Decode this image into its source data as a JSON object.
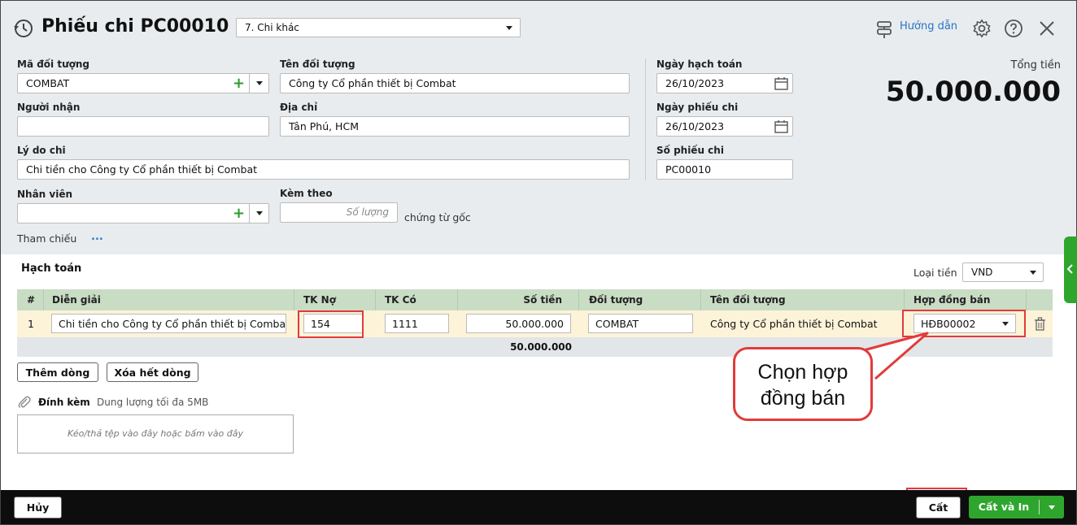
{
  "header": {
    "title": "Phiếu chi PC00010",
    "type_select": "7. Chi khác",
    "guide_label": "Hướng dẫn"
  },
  "form": {
    "ma_doi_tuong_label": "Mã đối tượng",
    "ma_doi_tuong_value": "COMBAT",
    "ten_doi_tuong_label": "Tên đối tượng",
    "ten_doi_tuong_value": "Công ty Cổ phần thiết bị Combat",
    "nguoi_nhan_label": "Người nhận",
    "nguoi_nhan_value": "",
    "dia_chi_label": "Địa chỉ",
    "dia_chi_value": "Tân Phú, HCM",
    "ly_do_chi_label": "Lý do chi",
    "ly_do_chi_value": "Chi tiền cho Công ty Cổ phần thiết bị Combat",
    "nhan_vien_label": "Nhân viên",
    "nhan_vien_value": "",
    "kem_theo_label": "Kèm theo",
    "so_luong_placeholder": "Số lượng",
    "chung_tu_goc": "chứng từ gốc",
    "tham_chieu_label": "Tham chiếu",
    "tham_chieu_more": "...",
    "ngay_hach_toan_label": "Ngày hạch toán",
    "ngay_hach_toan_value": "26/10/2023",
    "ngay_phieu_chi_label": "Ngày phiếu chi",
    "ngay_phieu_chi_value": "26/10/2023",
    "so_phieu_chi_label": "Số phiếu chi",
    "so_phieu_chi_value": "PC00010",
    "tong_tien_label": "Tổng tiền",
    "tong_tien_value": "50.000.000"
  },
  "hach_toan": {
    "title": "Hạch toán",
    "loai_tien_label": "Loại tiền",
    "loai_tien_value": "VND",
    "columns": [
      "#",
      "Diễn giải",
      "TK Nợ",
      "TK Có",
      "Số tiền",
      "Đối tượng",
      "Tên đối tượng",
      "Hợp đồng bán"
    ],
    "row": {
      "index": "1",
      "dien_giai": "Chi tiền cho Công ty Cổ phần thiết bị Combat",
      "tk_no": "154",
      "tk_co": "1111",
      "so_tien": "50.000.000",
      "doi_tuong": "COMBAT",
      "ten_doi_tuong": "Công ty Cổ phần thiết bị Combat",
      "hop_dong_ban": "HĐB00002"
    },
    "total": "50.000.000",
    "add_row_label": "Thêm dòng",
    "clear_rows_label": "Xóa hết dòng"
  },
  "attach": {
    "label": "Đính kèm",
    "hint": "Dung lượng tối đa 5MB",
    "dropzone": "Kéo/thả tệp vào đây hoặc bấm vào đây"
  },
  "callout": {
    "line1": "Chọn hợp",
    "line2": "đồng bán"
  },
  "footer": {
    "cancel_label": "Hủy",
    "save_label": "Cất",
    "save_print_label": "Cất và In"
  },
  "colors": {
    "accent_green": "#2ea62e",
    "highlight_red": "#e23b3b",
    "grid_header": "#c9dcc4",
    "link_blue": "#2a73c4"
  }
}
